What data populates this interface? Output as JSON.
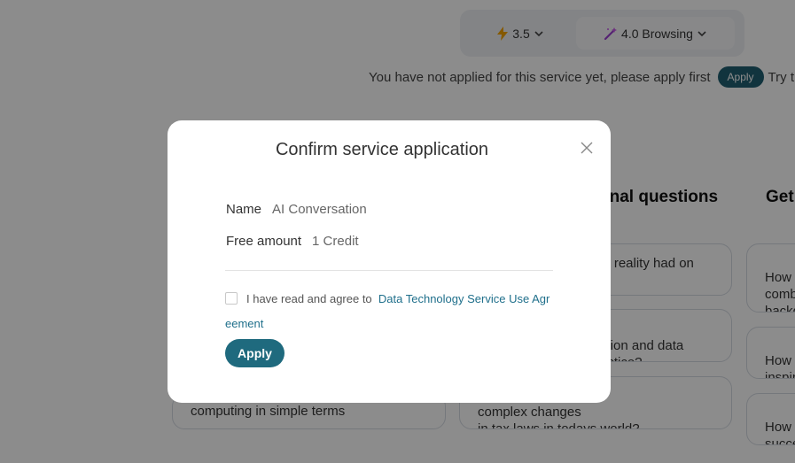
{
  "models": {
    "m35_label": "3.5",
    "m40_label": "4.0 Browsing"
  },
  "notice": {
    "text": "You have not applied for this service yet, please apply first",
    "apply_label": "Apply",
    "try_label": "Try t"
  },
  "sections": {
    "col2_title": "onal questions",
    "col3_title": "Get"
  },
  "cards": {
    "c1": "computing in simple terms",
    "c2": "al reality had on",
    "c3": "ction and data\nactice?",
    "c4": "complex changes\nin tax laws in todays world?",
    "c5": "How\ncomb\nbackg",
    "c6": "How\ninspir",
    "c7": "How\nsucce"
  },
  "modal": {
    "title": "Confirm service application",
    "name_label": "Name",
    "name_value": "AI Conversation",
    "amount_label": "Free amount",
    "amount_value": "1 Credit",
    "agree_text": "I have read and agree to",
    "agree_link": "Data Technology Service Use Agreement",
    "apply_label": "Apply"
  },
  "colors": {
    "accent": "#1f6a7e",
    "link": "#1f6f8b",
    "overlay": "rgba(0,0,0,0.45)"
  }
}
